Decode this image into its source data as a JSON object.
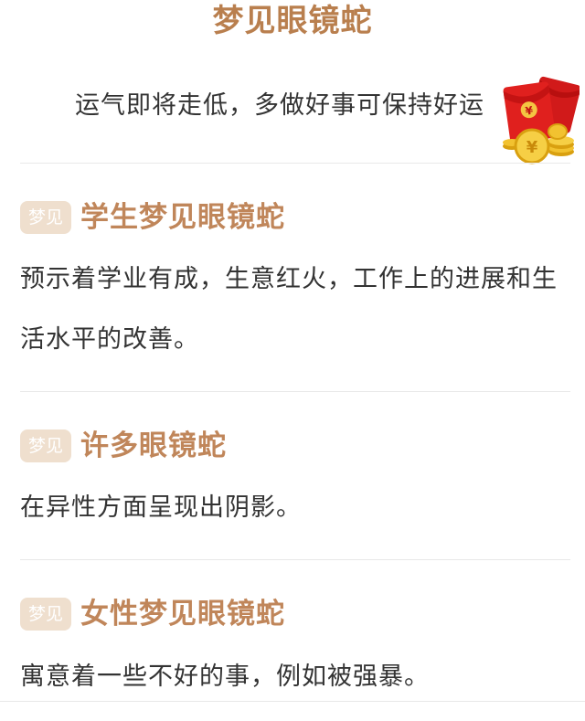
{
  "title": "梦见眼镜蛇",
  "fortune": {
    "text": "运气即将走低，多做好事可保持好运",
    "icon": "red-packet-icon"
  },
  "sections": [
    {
      "tag": "梦见",
      "title": "学生梦见眼镜蛇",
      "body": "预示着学业有成，生意红火，工作上的进展和生活水平的改善。"
    },
    {
      "tag": "梦见",
      "title": "许多眼镜蛇",
      "body": "在异性方面呈现出阴影。"
    },
    {
      "tag": "梦见",
      "title": "女性梦见眼镜蛇",
      "body": "寓意着一些不好的事，例如被强暴。"
    }
  ],
  "colors": {
    "accent": "#c0865a",
    "tag_bg": "#efdfce",
    "text": "#333333",
    "divider": "#e8e8e8"
  }
}
